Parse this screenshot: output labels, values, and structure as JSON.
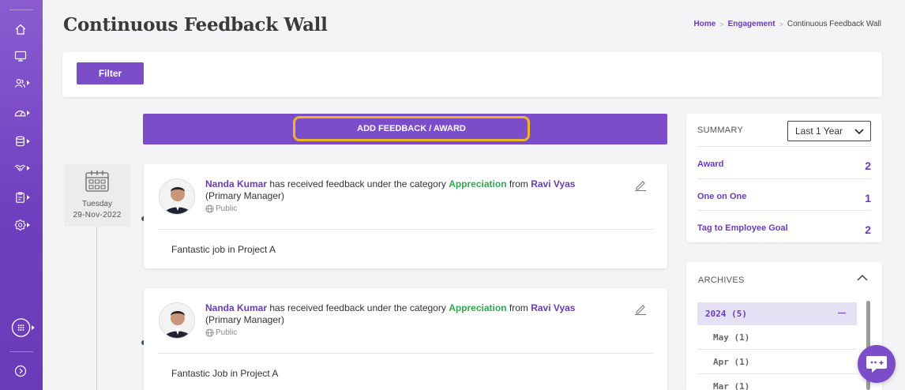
{
  "page": {
    "title": "Continuous Feedback Wall"
  },
  "breadcrumb": {
    "home": "Home",
    "section": "Engagement",
    "current": "Continuous Feedback Wall",
    "sep": ">"
  },
  "filter": {
    "label": "Filter"
  },
  "add_feedback": {
    "label": "ADD FEEDBACK / AWARD"
  },
  "timeline": {
    "day": "Tuesday",
    "date": "29-Nov-2022"
  },
  "feed": [
    {
      "recipient": "Nanda Kumar",
      "text_received": " has received feedback under the category ",
      "category": "Appreciation",
      "text_from": " from ",
      "giver": "Ravi Vyas",
      "giver_role": " (Primary Manager)",
      "visibility": "Public",
      "message": "Fantastic job in Project A"
    },
    {
      "recipient": "Nanda Kumar",
      "text_received": " has received feedback under the category ",
      "category": "Appreciation",
      "text_from": " from ",
      "giver": "Ravi Vyas",
      "giver_role": " (Primary Manager)",
      "visibility": "Public",
      "message": "Fantastic Job in Project A"
    }
  ],
  "summary": {
    "heading": "SUMMARY",
    "period": "Last 1 Year",
    "rows": [
      {
        "label": "Award",
        "count": "2"
      },
      {
        "label": "One on One",
        "count": "1"
      },
      {
        "label": "Tag to Employee Goal",
        "count": "2"
      }
    ]
  },
  "archives": {
    "heading": "ARCHIVES",
    "year": "2024 (5)",
    "months": [
      "May (1)",
      "Apr (1)",
      "Mar (1)"
    ]
  },
  "colors": {
    "brand": "#7b4dc8",
    "link": "#6a3bb8",
    "category": "#2fa84f",
    "highlight": "#f0b429"
  },
  "sidebar_icons": [
    "home-icon",
    "monitor-icon",
    "people-icon",
    "dashboard-gauge-icon",
    "database-icon",
    "handshake-icon",
    "clipboard-icon",
    "settings-icon",
    "apps-grid-icon",
    "expand-icon"
  ]
}
